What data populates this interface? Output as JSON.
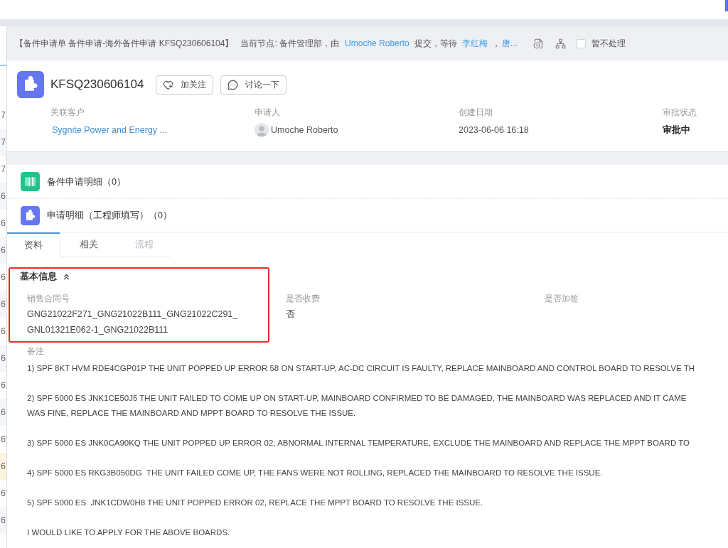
{
  "side_list": {
    "rows": [
      {
        "text": "7",
        "selected": false
      },
      {
        "text": "7",
        "selected": false
      },
      {
        "text": "7",
        "selected": false
      },
      {
        "text": "6",
        "selected": false
      },
      {
        "text": "6",
        "selected": false
      },
      {
        "text": "6",
        "selected": false
      },
      {
        "text": "6",
        "selected": false
      },
      {
        "text": "6",
        "selected": false
      },
      {
        "text": "6",
        "selected": false
      },
      {
        "text": "6",
        "selected": false
      },
      {
        "text": "6",
        "selected": false
      },
      {
        "text": "6",
        "selected": false
      },
      {
        "text": "6",
        "selected": false
      },
      {
        "text": "6",
        "selected": true
      },
      {
        "text": "6",
        "selected": false
      },
      {
        "text": "6",
        "selected": false
      }
    ]
  },
  "header_bar": {
    "record_title": "【备件申请单 备件申请-海外备件申请 KFSQ230606104】",
    "node_text": "当前节点: 备件管理部，由",
    "submitter": "Umoche Roberto",
    "submitted_text": "提交，等待",
    "assignees": [
      "李红梅",
      "唐..."
    ],
    "assignee_separator": "，",
    "hold": {
      "label": "暂不处理",
      "checked": false
    }
  },
  "record": {
    "title": "KFSQ230606104",
    "buttons": [
      {
        "kind": "follow",
        "label": "加关注"
      },
      {
        "kind": "discuss",
        "label": "讨论一下"
      }
    ],
    "fields": [
      {
        "kind": "link",
        "label": "关联客户",
        "value": "Sygnite Power and Energy ..."
      },
      {
        "kind": "user",
        "label": "申请人",
        "value": "Umoche Roberto"
      },
      {
        "kind": "text",
        "label": "创建日期",
        "value": "2023-06-06 16:18"
      },
      {
        "kind": "status",
        "label": "审批状态",
        "value": "审批中"
      }
    ]
  },
  "related_lists": [
    {
      "kind": "spare_parts",
      "label": "备件申请明细（0）"
    },
    {
      "kind": "engineer_form",
      "label": "申请明细（工程师填写）（0）"
    }
  ],
  "tabs": [
    {
      "label": "资料",
      "selected": true,
      "disabled": false
    },
    {
      "label": "相关",
      "selected": false,
      "disabled": false
    },
    {
      "label": "流程",
      "selected": false,
      "disabled": true
    }
  ],
  "basic_info": {
    "title": "基本信息",
    "expanded": true,
    "fields": [
      {
        "label": "销售合同号",
        "lines": [
          "GNG21022F271_GNG21022B111_GNG21022C291_",
          "GNL01321E062-1_GNG21022B111"
        ]
      },
      {
        "label": "是否收费",
        "lines": [
          "否"
        ]
      },
      {
        "label": "是否加签"
      }
    ]
  },
  "remarks": {
    "label": "备注",
    "paragraphs": [
      [
        "1) SPF 8KT HVM RDE4CGP01P THE UNIT POPPED UP ERROR 58 ON START-UP, AC-DC CIRCUIT IS FAULTY, REPLACE MAINBOARD AND CONTROL BOARD TO RESOLVE TH"
      ],
      [
        "2) SPF 5000 ES JNK1CE50J5 THE UNIT FAILED TO COME UP ON START-UP, MAINBOARD CONFIRMED TO BE DAMAGED, THE MAINBOARD WAS REPLACED AND IT CAME",
        "WAS FINE, REPLACE THE MAINBOARD AND MPPT BOARD TO RESOLVE THE ISSUE."
      ],
      [
        "3) SPF 5000 ES JNK0CA90KQ THE UNIT POPPED UP ERROR 02, ABNORMAL INTERNAL TEMPERATURE, EXCLUDE THE MAINBOARD AND REPLACE THE MPPT BOARD TO"
      ],
      [
        "4) SPF 5000 ES RKG3B050DG  THE UNIT FAILED COME UP, THE FANS WERE NOT ROLLING, REPLACED THE MAINBOARD TO RESOLVE THE ISSUE."
      ],
      [
        "5) SPF 5000 ES  JNK1CDW0H8 THE UNIT POPPED ERROR 02, REPLACE THE MPPT BOARD TO RESOLVE THE ISSUE."
      ],
      [
        "I WOULD LIKE TO APPLY FOR THE ABOVE BOARDS."
      ]
    ]
  }
}
